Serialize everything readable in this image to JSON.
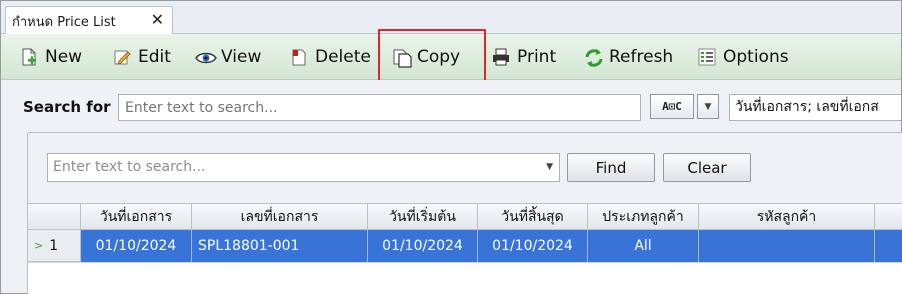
{
  "tab": {
    "title": "กำหนด Price List",
    "close_glyph": "✕"
  },
  "toolbar": {
    "new_label": "New",
    "edit_label": "Edit",
    "view_label": "View",
    "delete_label": "Delete",
    "copy_label": "Copy",
    "print_label": "Print",
    "refresh_label": "Refresh",
    "options_label": "Options"
  },
  "search": {
    "label": "Search for",
    "placeholder": "Enter text to search...",
    "match_mode": "A⊡C",
    "fields": "วันที่เอกสาร; เลขที่เอกส"
  },
  "filter": {
    "placeholder": "Enter text to search...",
    "find_label": "Find",
    "clear_label": "Clear"
  },
  "grid": {
    "columns": [
      "วันที่เอกสาร",
      "เลขที่เอกสาร",
      "วันที่เริ่มต้น",
      "วันที่สิ้นสุด",
      "ประเภทลูกค้า",
      "รหัสลูกค้า"
    ],
    "rows": [
      {
        "index": "1",
        "doc_date": "01/10/2024",
        "doc_no": "SPL18801-001",
        "start_date": "01/10/2024",
        "end_date": "01/10/2024",
        "customer_type": "All",
        "customer_code": ""
      }
    ]
  },
  "colors": {
    "highlight": "#e0262b",
    "selected_row": "#3873d7",
    "toolbar_bg": "#d9eadc"
  }
}
